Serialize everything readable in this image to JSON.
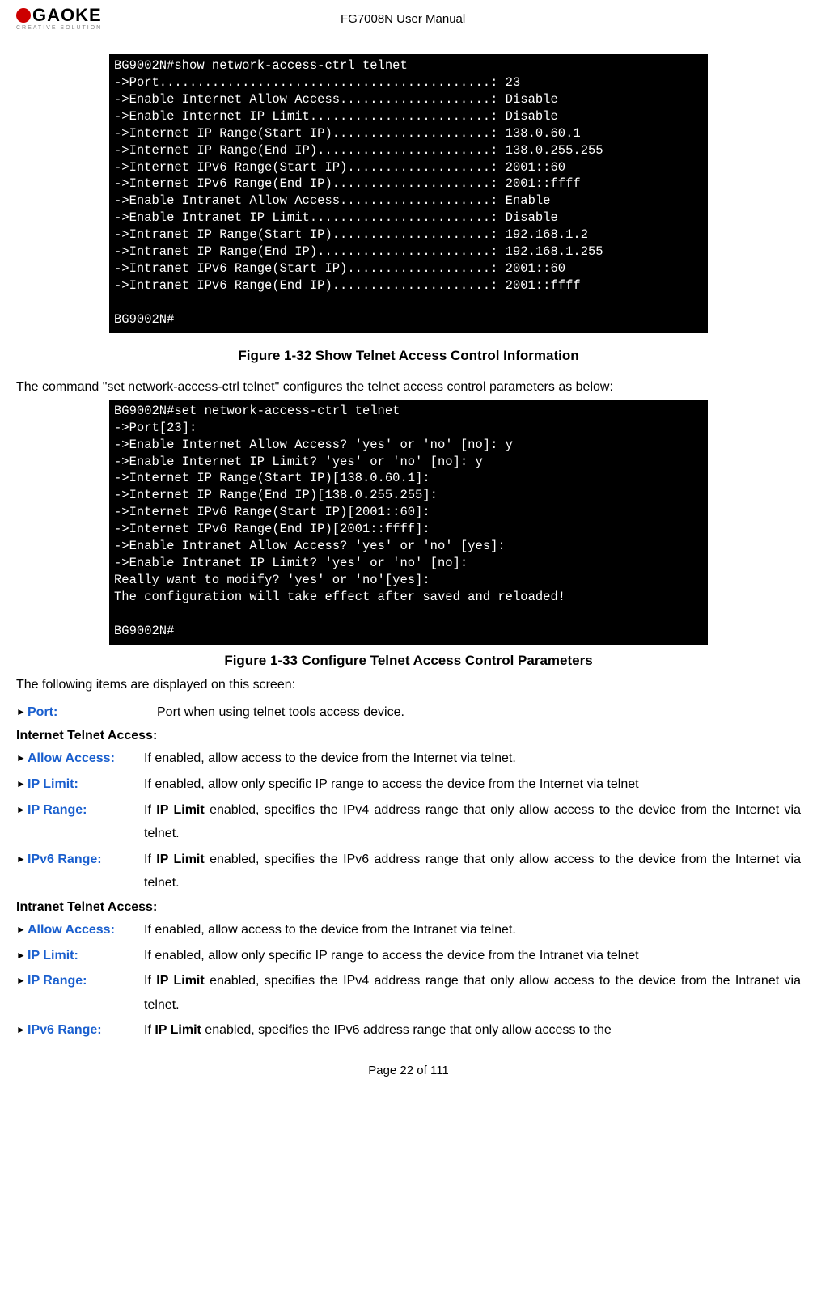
{
  "header": {
    "logo_text": "GAOKE",
    "logo_tagline": "CREATIVE SOLUTION",
    "doc_title": "FG7008N User Manual"
  },
  "terminal1": "BG9002N#show network-access-ctrl telnet\n->Port............................................: 23\n->Enable Internet Allow Access....................: Disable\n->Enable Internet IP Limit........................: Disable\n->Internet IP Range(Start IP).....................: 138.0.60.1\n->Internet IP Range(End IP).......................: 138.0.255.255\n->Internet IPv6 Range(Start IP)...................: 2001::60\n->Internet IPv6 Range(End IP).....................: 2001::ffff\n->Enable Intranet Allow Access....................: Enable\n->Enable Intranet IP Limit........................: Disable\n->Intranet IP Range(Start IP).....................: 192.168.1.2\n->Intranet IP Range(End IP).......................: 192.168.1.255\n->Intranet IPv6 Range(Start IP)...................: 2001::60\n->Intranet IPv6 Range(End IP).....................: 2001::ffff\n\nBG9002N#",
  "caption1": "Figure 1-32    Show Telnet Access Control Information",
  "intro1": "The command \"set network-access-ctrl telnet\" configures the telnet access control parameters as below:",
  "terminal2": "BG9002N#set network-access-ctrl telnet\n->Port[23]:\n->Enable Internet Allow Access? 'yes' or 'no' [no]: y\n->Enable Internet IP Limit? 'yes' or 'no' [no]: y\n->Internet IP Range(Start IP)[138.0.60.1]:\n->Internet IP Range(End IP)[138.0.255.255]:\n->Internet IPv6 Range(Start IP)[2001::60]:\n->Internet IPv6 Range(End IP)[2001::ffff]:\n->Enable Intranet Allow Access? 'yes' or 'no' [yes]:\n->Enable Intranet IP Limit? 'yes' or 'no' [no]:\nReally want to modify? 'yes' or 'no'[yes]:\nThe configuration will take effect after saved and reloaded!\n\nBG9002N#",
  "caption2": "Figure 1-33    Configure Telnet Access Control Parameters",
  "intro2": "The following items are displayed on this screen:",
  "port": {
    "label": "Port:",
    "text": "Port when using telnet tools access device."
  },
  "section_internet": "Internet Telnet Access:",
  "internet": {
    "allow_access": {
      "label": "Allow Access:",
      "text": "If enabled, allow access to the device from the Internet via telnet."
    },
    "ip_limit": {
      "label": "IP Limit:",
      "text": "If enabled, allow only specific IP range to access the device from the Internet via telnet"
    },
    "ip_range": {
      "label": "IP Range:",
      "prefix": "If ",
      "bold": "IP Limit",
      "suffix": " enabled, specifies the IPv4 address range that only allow access to the device from the Internet via telnet."
    },
    "ipv6_range": {
      "label": "IPv6 Range:",
      "prefix": "If ",
      "bold": "IP Limit",
      "suffix": " enabled, specifies the IPv6 address range that only allow access to the device from the Internet via telnet."
    }
  },
  "section_intranet": "Intranet Telnet Access:",
  "intranet": {
    "allow_access": {
      "label": "Allow Access:",
      "text": "If enabled, allow access to the device from the Intranet via telnet."
    },
    "ip_limit": {
      "label": "IP Limit:",
      "text": "If enabled, allow only specific IP range to access the device from the Intranet via telnet"
    },
    "ip_range": {
      "label": "IP Range:",
      "prefix": "If ",
      "bold": "IP Limit",
      "suffix": " enabled, specifies the IPv4 address range that only allow access to the device from the Intranet via telnet."
    },
    "ipv6_range": {
      "label": "IPv6 Range:",
      "prefix": "If ",
      "bold": "IP Limit",
      "suffix": " enabled, specifies the IPv6 address range that only allow access to the"
    }
  },
  "footer": "Page 22 of 111"
}
